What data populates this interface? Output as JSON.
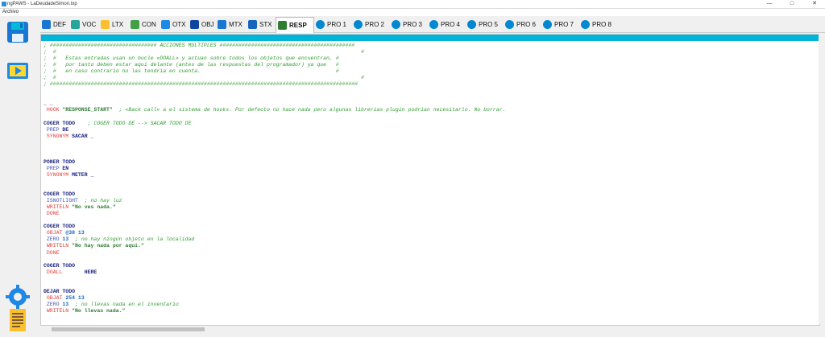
{
  "window": {
    "title": "ngPAWS - LaDeudadeSimon.txp",
    "minimize": "—",
    "maximize": "□",
    "close": "✕"
  },
  "menu": {
    "file": "Archivo"
  },
  "sidebar": [
    {
      "name": "save-icon"
    },
    {
      "name": "run-icon"
    },
    {
      "name": "settings-gear-icon"
    },
    {
      "name": "document-icon"
    }
  ],
  "tabs": [
    {
      "label": "DEF",
      "icon": "shield-icon",
      "color": "#1976d2"
    },
    {
      "label": "VOC",
      "icon": "voc-icon",
      "color": "#26a69a"
    },
    {
      "label": "LTX",
      "icon": "picture-icon",
      "color": "#fbc02d"
    },
    {
      "label": "CON",
      "icon": "globe-icon",
      "color": "#43a047"
    },
    {
      "label": "OTX",
      "icon": "doc-list-icon",
      "color": "#1e88e5"
    },
    {
      "label": "OBJ",
      "icon": "bag-icon",
      "color": "#0d47a1"
    },
    {
      "label": "MTX",
      "icon": "pen-icon",
      "color": "#1976d2"
    },
    {
      "label": "STX",
      "icon": "signpost-icon",
      "color": "#1565c0"
    },
    {
      "label": "RESP",
      "icon": "book-icon",
      "color": "#2e7d32"
    },
    {
      "label": "PRO 1",
      "icon": "gear-icon",
      "color": "#0288d1"
    },
    {
      "label": "PRO 2",
      "icon": "gear-icon",
      "color": "#0288d1"
    },
    {
      "label": "PRO 3",
      "icon": "gear-icon",
      "color": "#0288d1"
    },
    {
      "label": "PRO 4",
      "icon": "gear-icon",
      "color": "#0288d1"
    },
    {
      "label": "PRO 5",
      "icon": "gear-icon",
      "color": "#0288d1"
    },
    {
      "label": "PRO 6",
      "icon": "gear-icon",
      "color": "#0288d1"
    },
    {
      "label": "PRO 7",
      "icon": "gear-icon",
      "color": "#0288d1"
    },
    {
      "label": "PRO 8",
      "icon": "gear-icon",
      "color": "#0288d1"
    }
  ],
  "active_tab": "RESP",
  "editor": {
    "lines": [
      [
        [
          "c",
          "; ################################## ACCIONES MULTIPLES ###########################################"
        ]
      ],
      [
        [
          "c",
          ";  #                                                                                                 #"
        ]
      ],
      [
        [
          "c",
          ";  #   Estas entradas usan un bucle «DOALL» y actuan sobre todos los objetos que encuentran, #"
        ]
      ],
      [
        [
          "c",
          ";  #   por tanto deben estar aqui delante (antes de las respuestas del programador) ya que   #"
        ]
      ],
      [
        [
          "c",
          ";  #   en caso contrario no las tendria en cuenta.                                           #"
        ]
      ],
      [
        [
          "c",
          ";  #                                                                                                 #"
        ]
      ],
      [
        [
          "c",
          "; ##################################################################################################"
        ]
      ],
      [],
      [],
      [
        [
          "k",
          "_ _"
        ]
      ],
      [
        [
          "r",
          " HOOK "
        ],
        [
          "s",
          "\"RESPONSE_START\""
        ],
        [
          "c",
          "  ; «Back call» a el sistema de hooks. Por defecto no hace nada pero algunas librerias plugin podrian necesitarlo. No borrar."
        ]
      ],
      [],
      [
        [
          "k",
          "COGER TODO"
        ],
        [
          "c",
          "    ; COGER TODO DE --> SACAR TODO DE"
        ]
      ],
      [
        [
          "b",
          " PREP "
        ],
        [
          "k",
          "DE"
        ]
      ],
      [
        [
          "r",
          " SYNONYM "
        ],
        [
          "k",
          "SACAR _"
        ]
      ],
      [],
      [],
      [],
      [
        [
          "k",
          "PONER TODO"
        ]
      ],
      [
        [
          "b",
          " PREP "
        ],
        [
          "k",
          "EN"
        ]
      ],
      [
        [
          "r",
          " SYNONYM "
        ],
        [
          "k",
          "METER _"
        ]
      ],
      [],
      [],
      [
        [
          "k",
          "COGER TODO"
        ]
      ],
      [
        [
          "b",
          " ISNOTLIGHT"
        ],
        [
          "c",
          "  ; no hay luz"
        ]
      ],
      [
        [
          "r",
          " WRITELN "
        ],
        [
          "s",
          "\"No ves nada.\""
        ]
      ],
      [
        [
          "r",
          " DONE"
        ]
      ],
      [],
      [
        [
          "k",
          "COGER TODO"
        ]
      ],
      [
        [
          "r",
          " OBJAT "
        ],
        [
          "n",
          "@38 13"
        ]
      ],
      [
        [
          "b",
          " ZERO "
        ],
        [
          "n",
          "13"
        ],
        [
          "c",
          "  ; no hay ningún objeto en la localidad"
        ]
      ],
      [
        [
          "r",
          " WRITELN "
        ],
        [
          "s",
          "\"No hay nada por aquí.\""
        ]
      ],
      [
        [
          "r",
          " DONE"
        ]
      ],
      [],
      [
        [
          "k",
          "COGER TODO"
        ]
      ],
      [
        [
          "r",
          " DOALL       "
        ],
        [
          "k",
          "HERE"
        ]
      ],
      [],
      [],
      [
        [
          "k",
          "DEJAR TODO"
        ]
      ],
      [
        [
          "r",
          " OBJAT "
        ],
        [
          "n",
          "254 13"
        ]
      ],
      [
        [
          "b",
          " ZERO "
        ],
        [
          "n",
          "13"
        ],
        [
          "c",
          "  ; no llevas nada en el inventario"
        ]
      ],
      [
        [
          "r",
          " WRITELN "
        ],
        [
          "s",
          "\"No llevas nada.\""
        ]
      ]
    ]
  }
}
